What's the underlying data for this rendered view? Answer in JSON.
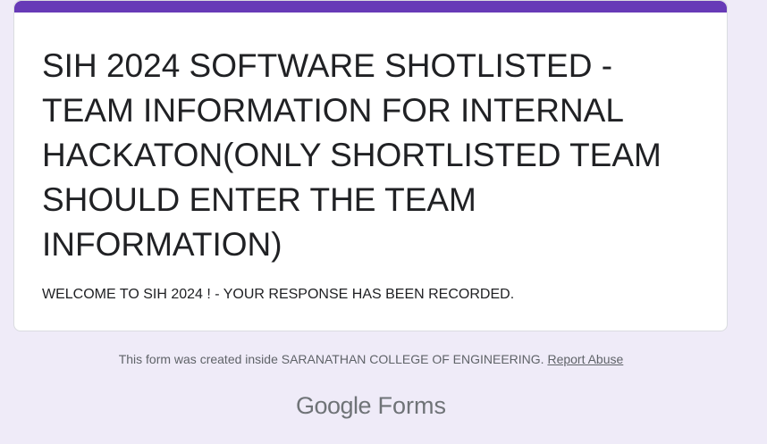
{
  "form": {
    "title": "SIH 2024 SOFTWARE SHOTLISTED - TEAM INFORMATION FOR INTERNAL HACKATON(ONLY SHORTLISTED TEAM SHOULD ENTER THE TEAM INFORMATION)",
    "confirmation_message": "WELCOME TO SIH 2024 ! - YOUR RESPONSE HAS BEEN RECORDED."
  },
  "footer": {
    "note": "This form was created inside SARANATHAN COLLEGE OF ENGINEERING.",
    "report_abuse_label": "Report Abuse"
  },
  "brand": {
    "google": "Google",
    "forms": "Forms"
  },
  "colors": {
    "accent": "#673ab7",
    "background": "#efebf8",
    "card": "#ffffff",
    "text": "#202124",
    "muted": "#5f6368"
  }
}
